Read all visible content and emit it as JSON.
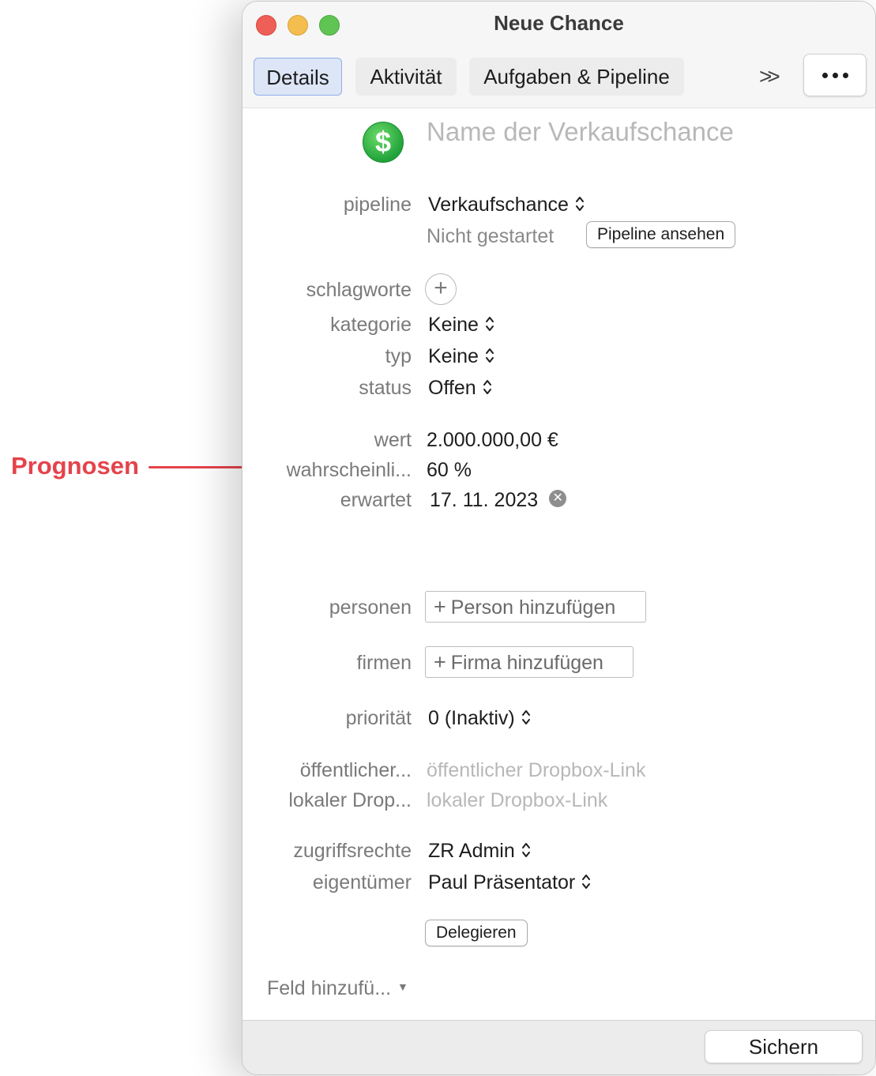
{
  "annotation": {
    "label": "Prognosen",
    "color": "#e5434b"
  },
  "window": {
    "title": "Neue Chance",
    "tabs": [
      {
        "label": "Details",
        "active": true
      },
      {
        "label": "Aktivität",
        "active": false
      },
      {
        "label": "Aufgaben & Pipeline",
        "active": false
      }
    ],
    "tab_overflow": ">>",
    "more_menu_icon": "ellipsis-icon"
  },
  "header": {
    "icon": "dollar-icon",
    "name_placeholder": "Name der Verkaufschance"
  },
  "fields": {
    "pipeline": {
      "label": "pipeline",
      "value": "Verkaufschance",
      "state": "Nicht gestartet",
      "button": "Pipeline ansehen"
    },
    "tags": {
      "label": "schlagworte"
    },
    "category": {
      "label": "kategorie",
      "value": "Keine"
    },
    "type": {
      "label": "typ",
      "value": "Keine"
    },
    "status": {
      "label": "status",
      "value": "Offen"
    },
    "value": {
      "label": "wert",
      "value": "2.000.000,00 €"
    },
    "probability": {
      "label": "wahrscheinli...",
      "value": "60 %"
    },
    "expected": {
      "label": "erwartet",
      "value": "17. 11. 2023"
    },
    "persons": {
      "label": "personen",
      "button": "Person hinzufügen"
    },
    "companies": {
      "label": "firmen",
      "button": "Firma hinzufügen"
    },
    "priority": {
      "label": "priorität",
      "value": "0 (Inaktiv)"
    },
    "public_dropbox": {
      "label": "öffentlicher...",
      "placeholder": "öffentlicher Dropbox-Link"
    },
    "local_dropbox": {
      "label": "lokaler Drop...",
      "placeholder": "lokaler Dropbox-Link"
    },
    "access": {
      "label": "zugriffsrechte",
      "value": "ZR Admin"
    },
    "owner": {
      "label": "eigentümer",
      "value": "Paul Präsentator"
    },
    "delegate_button": "Delegieren",
    "add_field": "Feld hinzufü..."
  },
  "footer": {
    "save": "Sichern"
  }
}
